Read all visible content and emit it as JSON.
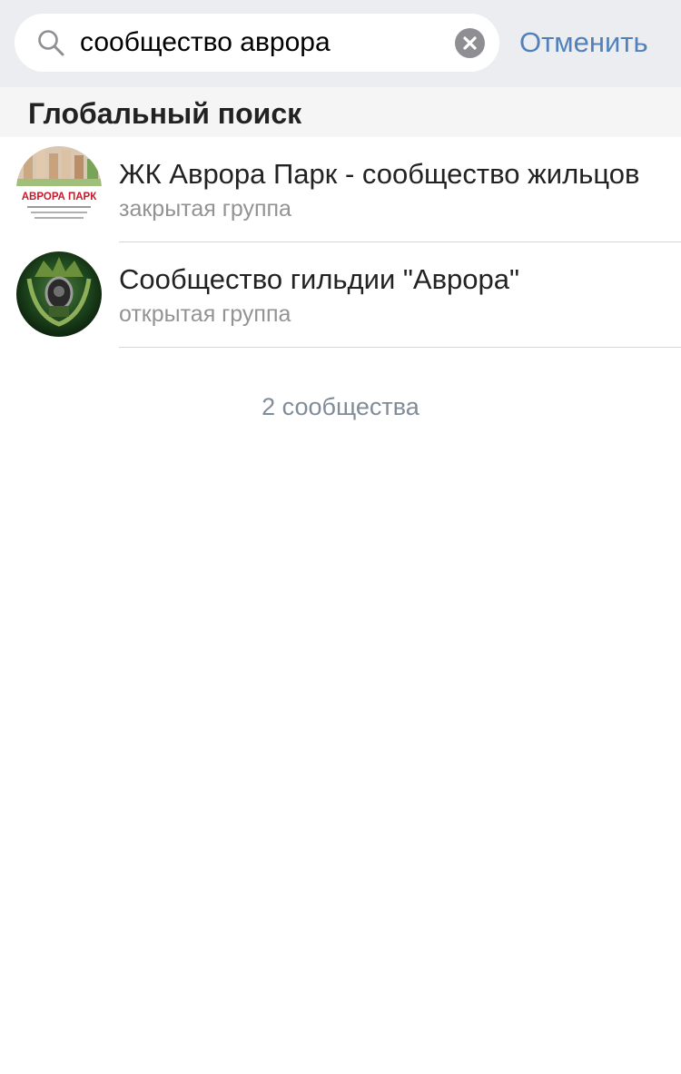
{
  "search": {
    "query": "сообщество аврора",
    "cancel_label": "Отменить"
  },
  "section": {
    "title": "Глобальный поиск"
  },
  "results": [
    {
      "title": "ЖК Аврора Парк - сообщество жильцов",
      "subtitle": "закрытая группа",
      "avatar_text": "АВРОРА ПАРК"
    },
    {
      "title": "Сообщество гильдии \"Аврора\"",
      "subtitle": "открытая группа"
    }
  ],
  "footer": {
    "count_label": "2 сообщества"
  },
  "colors": {
    "accent": "#5181b8",
    "search_bg": "#ebedf0",
    "section_bg": "#f5f5f5",
    "text_primary": "#222222",
    "text_secondary": "#939393",
    "footer_text": "#818c99"
  }
}
